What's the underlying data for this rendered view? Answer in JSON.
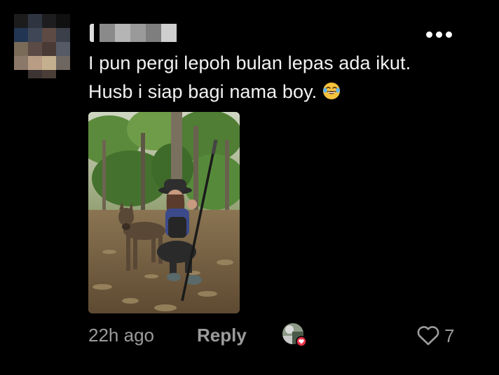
{
  "comment": {
    "lines": [
      "I pun pergi lepoh bulan lepas ada ikut.",
      "Husb i siap bagi nama boy."
    ],
    "emoji": "face-with-tears-of-joy-icon"
  },
  "footer": {
    "time": "22h ago",
    "reply_label": "Reply",
    "like_count": "7"
  },
  "colors": {
    "background": "#000000",
    "text": "#f2f2f2",
    "muted": "#9b9b9b",
    "heart_badge": "#e8334a"
  }
}
